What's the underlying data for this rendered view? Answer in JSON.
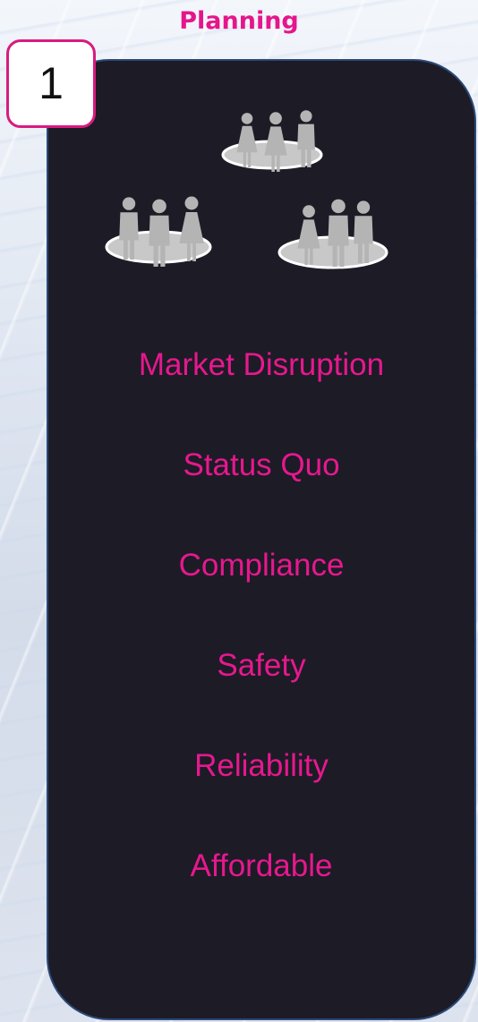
{
  "header": {
    "title": "Planning"
  },
  "step": {
    "number": "1"
  },
  "icons": [
    "people-group-icon",
    "people-group-icon",
    "people-group-icon"
  ],
  "colors": {
    "accent": "#e5168c",
    "panel_background": "#1d1b26",
    "panel_border": "#2a4a78",
    "icon_fill": "#b4b4b4"
  },
  "list": {
    "items": [
      {
        "label": "Market Disruption"
      },
      {
        "label": "Status Quo"
      },
      {
        "label": "Compliance"
      },
      {
        "label": "Safety"
      },
      {
        "label": "Reliability"
      },
      {
        "label": "Affordable"
      }
    ]
  }
}
